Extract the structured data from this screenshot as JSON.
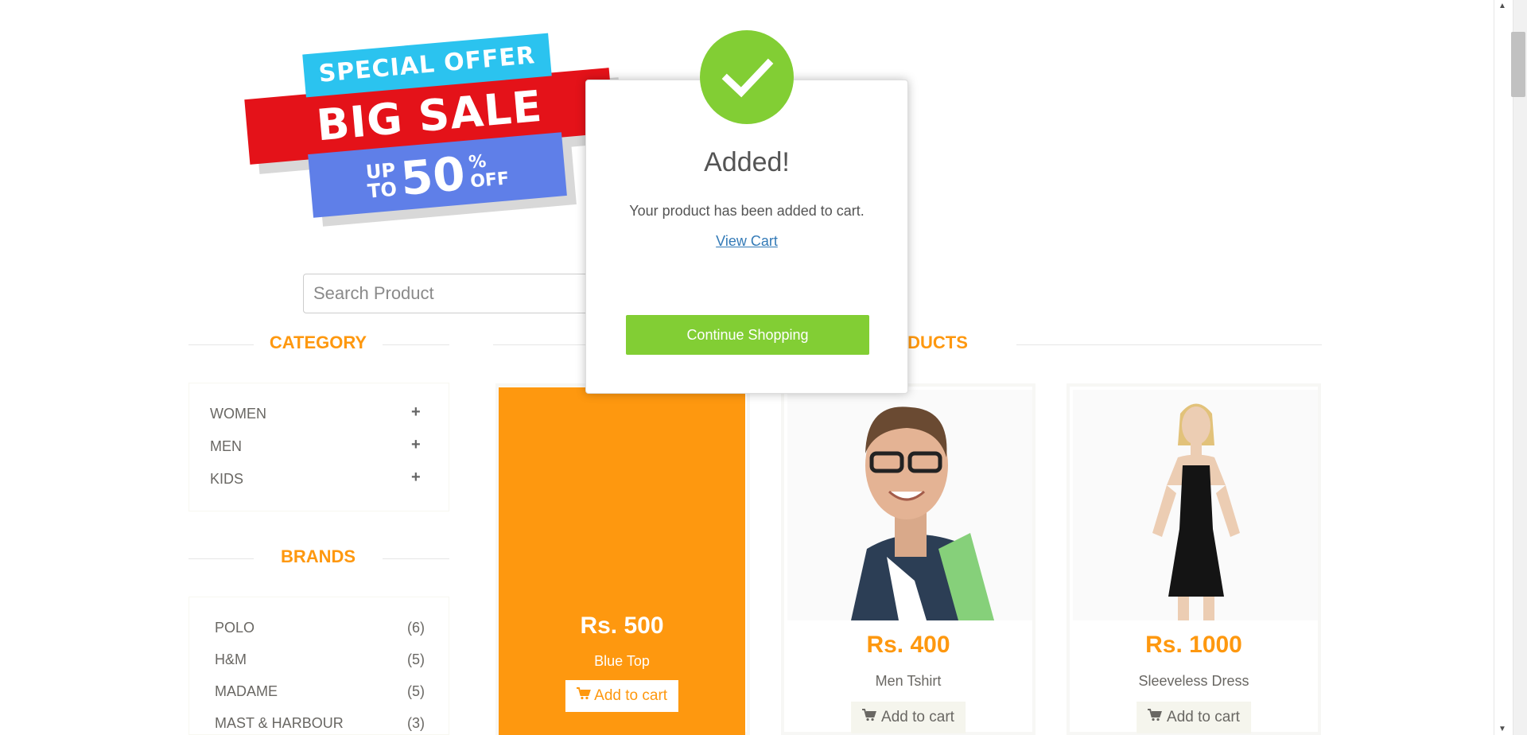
{
  "banner": {
    "line1": "SPECIAL OFFER",
    "line2": "BIG SALE",
    "upto_1": "UP",
    "upto_2": "TO",
    "percent": "50",
    "pct_sign": "%",
    "off": "OFF"
  },
  "search": {
    "placeholder": "Search Product"
  },
  "category": {
    "title": "CATEGORY",
    "items": [
      {
        "label": "WOMEN",
        "toggle": "+"
      },
      {
        "label": "MEN",
        "toggle": "+"
      },
      {
        "label": "KIDS",
        "toggle": "+"
      }
    ]
  },
  "brands": {
    "title": "BRANDS",
    "items": [
      {
        "label": "POLO",
        "count": "(6)"
      },
      {
        "label": "H&M",
        "count": "(5)"
      },
      {
        "label": "MADAME",
        "count": "(5)"
      },
      {
        "label": "MAST & HARBOUR",
        "count": "(3)"
      }
    ]
  },
  "products": {
    "title_partial": "ODUCTS",
    "items": [
      {
        "price": "Rs. 500",
        "name": "Blue Top",
        "button": "Add to cart"
      },
      {
        "price": "Rs. 400",
        "name": "Men Tshirt",
        "button": "Add to cart"
      },
      {
        "price": "Rs. 1000",
        "name": "Sleeveless Dress",
        "button": "Add to cart"
      }
    ]
  },
  "modal": {
    "title": "Added!",
    "message": "Your product has been added to cart.",
    "link": "View Cart",
    "button": "Continue Shopping"
  },
  "colors": {
    "accent": "#fe980f",
    "success": "#82ce34",
    "link": "#337ab7"
  },
  "icons": {
    "success": "check-icon",
    "cart": "shopping-cart-icon",
    "expand": "plus-icon"
  }
}
